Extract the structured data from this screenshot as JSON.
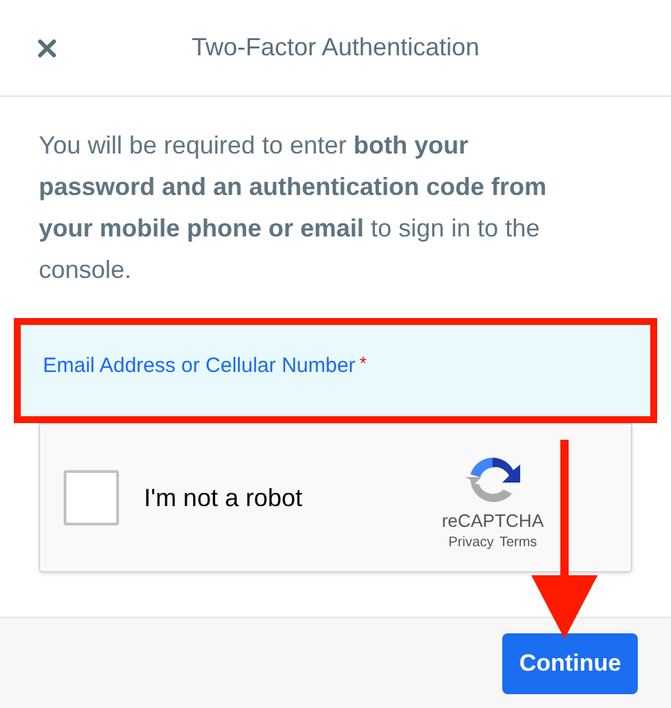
{
  "dialog": {
    "title": "Two-Factor Authentication",
    "description": "You will be required to enter **both your password and an authentication code from your mobile phone or email** to sign in to the console.",
    "field": {
      "label": "Email Address or Cellular Number",
      "required_mark": "*",
      "highlighted": true
    },
    "captcha": {
      "label": "I'm not a robot",
      "checked": false,
      "brand": "reCAPTCHA",
      "links": [
        "Privacy",
        "Terms"
      ]
    },
    "buttons": [
      "Continue"
    ]
  }
}
